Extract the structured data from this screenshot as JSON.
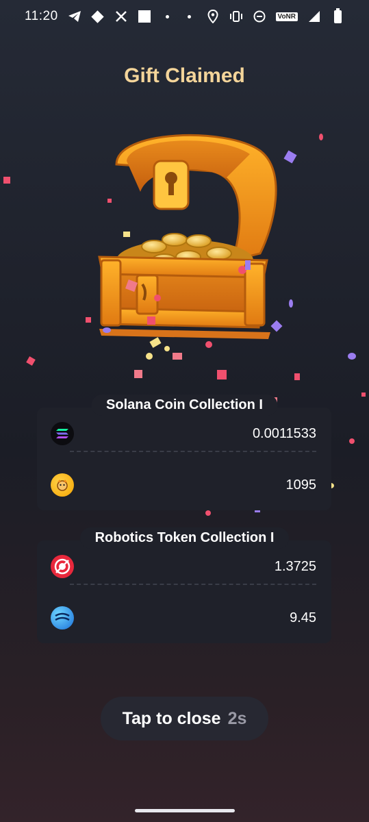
{
  "status_bar": {
    "time": "11:20",
    "left_icons": [
      "telegram-icon",
      "diamond-icon",
      "x-icon",
      "square-icon",
      "dot-icon"
    ],
    "right_icons": [
      "dot-icon",
      "location-icon",
      "vibrate-icon",
      "dnd-icon",
      "vonr-icon",
      "signal-icon",
      "battery-icon"
    ],
    "vonr_label": "VoNR"
  },
  "title": "Gift Claimed",
  "collections": [
    {
      "name": "Solana Coin Collection I",
      "tokens": [
        {
          "icon": "solana-icon",
          "amount": "0.0011533"
        },
        {
          "icon": "bonk-dog-icon",
          "amount": "1095"
        }
      ]
    },
    {
      "name": "Robotics Token Collection I",
      "tokens": [
        {
          "icon": "red-globe-token-icon",
          "amount": "1.3725"
        },
        {
          "icon": "blue-sphere-token-icon",
          "amount": "9.45"
        }
      ]
    }
  ],
  "close_button": {
    "label": "Tap to close",
    "countdown": "2s"
  },
  "colors": {
    "title": "#f4d59a",
    "card": "#1f212a",
    "button": "#272832"
  }
}
